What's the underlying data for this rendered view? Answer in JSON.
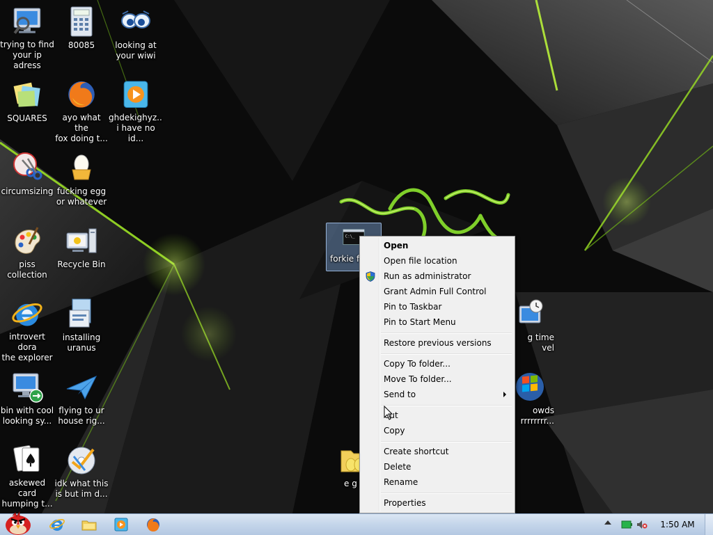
{
  "desktop": {
    "icons": [
      {
        "label": "trying to find\nyour ip adress",
        "icon": "network-computer-icon"
      },
      {
        "label": "80085",
        "icon": "calculator-icon"
      },
      {
        "label": "looking at\nyour wiwi",
        "icon": "eyes-icon"
      },
      {
        "label": "SQUARES",
        "icon": "sticky-notes-icon"
      },
      {
        "label": "ayo what the\nfox doing t...",
        "icon": "firefox-icon"
      },
      {
        "label": "ghdekighyz...\ni have no id...",
        "icon": "media-player-icon"
      },
      {
        "label": "circumsizing",
        "icon": "snipping-tool-icon"
      },
      {
        "label": "fucking egg\nor whatever",
        "icon": "egg-icon"
      },
      {
        "label": "piss\ncollection",
        "icon": "paint-palette-icon"
      },
      {
        "label": "Recycle Bin",
        "icon": "computer-recycle-icon"
      },
      {
        "label": "introvert dora\nthe explorer",
        "icon": "internet-explorer-icon"
      },
      {
        "label": "installing\nuranus",
        "icon": "installer-icon"
      },
      {
        "label": "bin with cool\nlooking sy...",
        "icon": "remote-desktop-icon"
      },
      {
        "label": "flying to ur\nhouse rig...",
        "icon": "paper-plane-icon"
      },
      {
        "label": "askewed card\nhumping t...",
        "icon": "playing-cards-icon"
      },
      {
        "label": "idk what this\nis but im d...",
        "icon": "checkmark-disc-icon"
      },
      {
        "label": "forkie f",
        "icon": "command-prompt-icon"
      },
      {
        "label": "g time\nvel",
        "icon": "clock-computer-icon"
      },
      {
        "label": "owds\nrrrrrrrr...",
        "icon": "windows-logo-icon"
      },
      {
        "label": "e g g",
        "icon": "folder-eggs-icon"
      }
    ]
  },
  "context_menu": {
    "items": [
      {
        "label": "Open",
        "bold": true
      },
      {
        "label": "Open file location"
      },
      {
        "label": "Run as administrator",
        "icon": "uac-shield-icon"
      },
      {
        "label": "Grant Admin Full Control"
      },
      {
        "label": "Pin to Taskbar"
      },
      {
        "label": "Pin to Start Menu"
      },
      {
        "label": "Restore previous versions"
      },
      {
        "label": "Copy To folder..."
      },
      {
        "label": "Move To folder..."
      },
      {
        "label": "Send to",
        "submenu": true
      },
      {
        "label": "Cut"
      },
      {
        "label": "Copy"
      },
      {
        "label": "Create shortcut"
      },
      {
        "label": "Delete"
      },
      {
        "label": "Rename"
      },
      {
        "label": "Properties"
      }
    ]
  },
  "taskbar": {
    "pinned": [
      "internet-explorer-icon",
      "windows-explorer-icon",
      "media-player-icon",
      "firefox-icon"
    ],
    "tray": [
      "show-hidden-icons-arrow",
      "battery-icon",
      "volume-muted-icon"
    ],
    "clock": "1:50 AM"
  },
  "colors": {
    "wallpaper": "#0b0b0b",
    "accent_green": "#9be024",
    "menu_bg": "#f0f0f0",
    "taskbar": "#c4d5ea"
  }
}
